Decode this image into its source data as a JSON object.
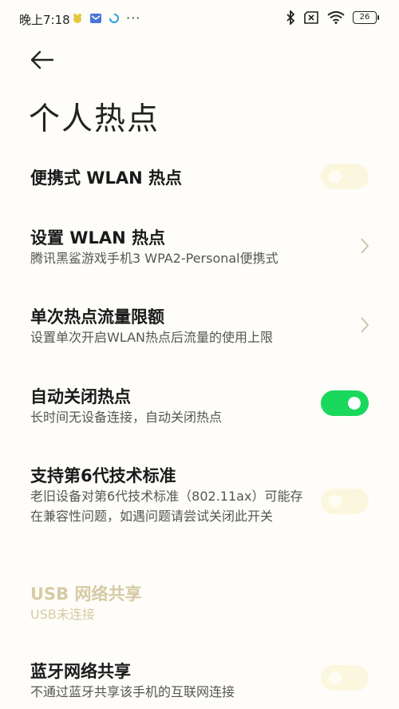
{
  "status": {
    "time": "晚上7:18",
    "battery": "26"
  },
  "page": {
    "title": "个人热点"
  },
  "rows": [
    {
      "title": "便携式 WLAN 热点",
      "toggle": "off"
    },
    {
      "title": "设置 WLAN 热点",
      "subtitle": "腾讯黑鲨游戏手机3 WPA2-Personal便携式"
    },
    {
      "title": "单次热点流量限额",
      "subtitle": "设置单次开启WLAN热点后流量的使用上限"
    },
    {
      "title": "自动关闭热点",
      "subtitle": "长时间无设备连接，自动关闭热点",
      "toggle": "on"
    },
    {
      "title": "支持第6代技术标准",
      "subtitle": "老旧设备对第6代技术标准（802.11ax）可能存在兼容性问题，如遇问题请尝试关闭此开关",
      "toggle": "off"
    },
    {
      "title": "USB 网络共享",
      "subtitle": "USB未连接",
      "state": "disabled"
    },
    {
      "title": "蓝牙网络共享",
      "subtitle": "不通过蓝牙共享该手机的互联网连接",
      "toggle": "off"
    }
  ],
  "colors": {
    "accent": "#19d85c",
    "toggle_off": "#fbf7de",
    "disabled_text": "#d6cba4"
  }
}
